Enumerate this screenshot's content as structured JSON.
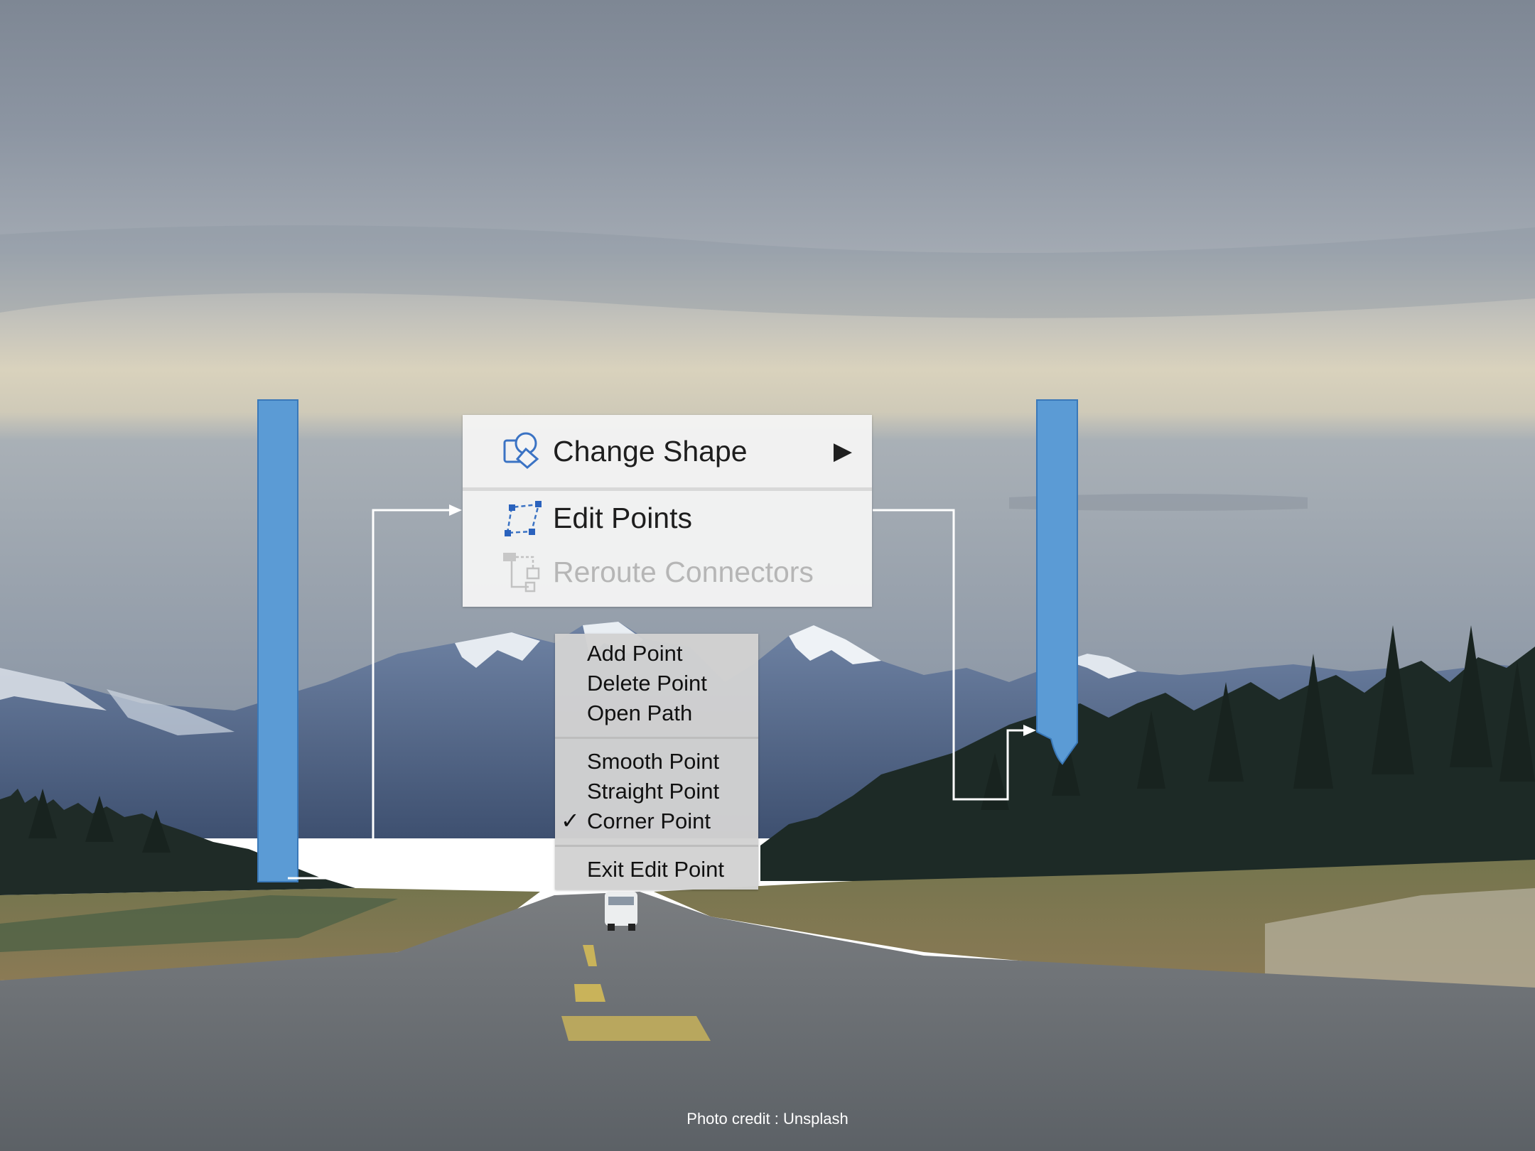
{
  "context_menu": {
    "change_shape": "Change Shape",
    "edit_points": "Edit Points",
    "reroute_connectors": "Reroute Connectors"
  },
  "submenu": {
    "add_point": "Add Point",
    "delete_point": "Delete Point",
    "open_path": "Open Path",
    "smooth_point": "Smooth Point",
    "straight_point": "Straight Point",
    "corner_point": "Corner Point",
    "exit_edit_point": "Exit Edit Point",
    "checked_item": "Corner Point"
  },
  "icons": [
    "change-shape-icon",
    "edit-points-icon",
    "reroute-connectors-icon",
    "submenu-arrow-icon",
    "checkmark-icon"
  ],
  "colors": {
    "shape_blue": "#5b9bd5",
    "connector": "#ffffff"
  },
  "footer": {
    "credit": "Photo credit : Unsplash"
  }
}
